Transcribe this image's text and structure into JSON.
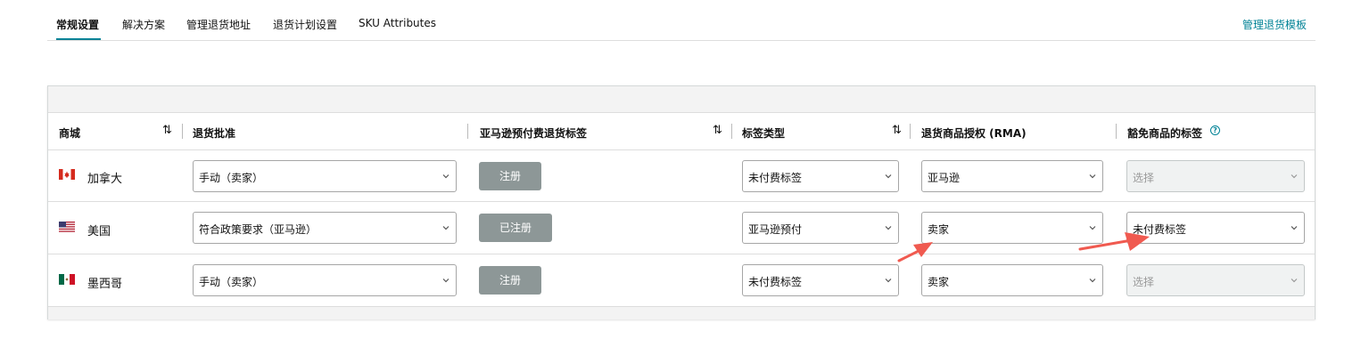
{
  "tabs": {
    "items": [
      "常规设置",
      "解决方案",
      "管理退货地址",
      "退货计划设置",
      "SKU Attributes"
    ],
    "manage_templates": "管理退货模板"
  },
  "table": {
    "columns": {
      "marketplace": "商城",
      "return_approval": "退货批准",
      "prepaid_label": "亚马逊预付费退货标签",
      "label_type": "标签类型",
      "rma": "退货商品授权 (RMA)",
      "exempt_label": "豁免商品的标签"
    },
    "rows": [
      {
        "country": "加拿大",
        "return_approval": "手动（卖家）",
        "prepaid_button": "注册",
        "label_type": "未付费标签",
        "rma": "亚马逊",
        "exempt_label": "选择"
      },
      {
        "country": "美国",
        "return_approval": "符合政策要求（亚马逊）",
        "prepaid_button": "已注册",
        "label_type": "亚马逊预付",
        "rma": "卖家",
        "exempt_label": "未付费标签"
      },
      {
        "country": "墨西哥",
        "return_approval": "手动（卖家）",
        "prepaid_button": "注册",
        "label_type": "未付费标签",
        "rma": "卖家",
        "exempt_label": "选择"
      }
    ]
  },
  "colors": {
    "accent": "#008296",
    "button_gray": "#8d9797",
    "annotation_arrow": "#f05a50"
  },
  "icons": {
    "sort": "sort-arrows-icon",
    "help": "help-circle-icon",
    "chevron": "chevron-down-icon"
  }
}
